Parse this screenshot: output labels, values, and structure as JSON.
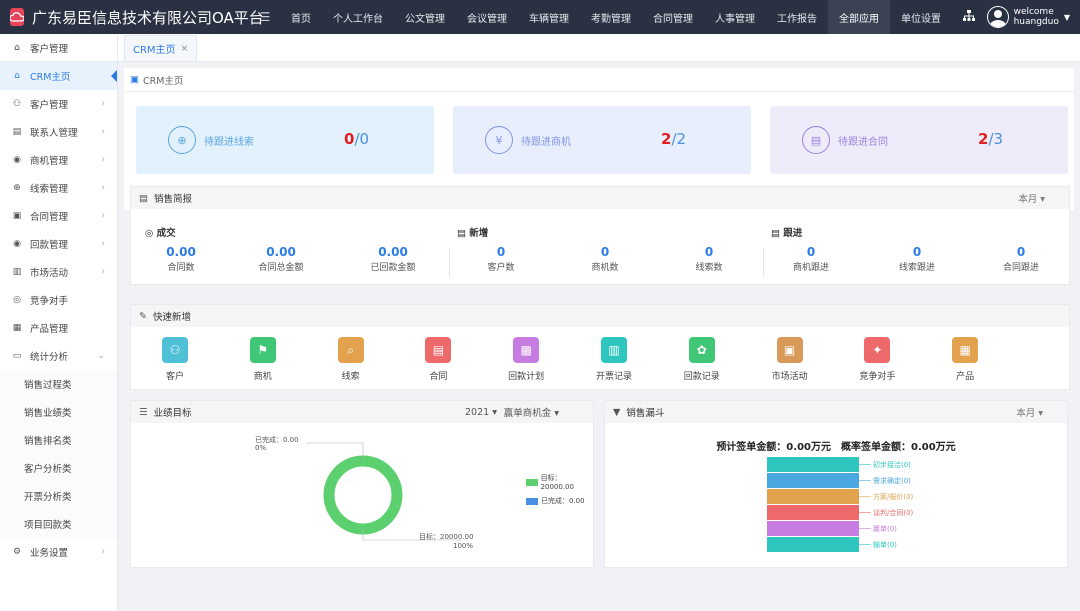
{
  "app": {
    "title": "广东易臣信息技术有限公司OA平台"
  },
  "nav": [
    "首页",
    "个人工作台",
    "公文管理",
    "会议管理",
    "车辆管理",
    "考勤管理",
    "合同管理",
    "人事管理",
    "工作报告",
    "全部应用",
    "单位设置"
  ],
  "user": {
    "line1": "welcome",
    "line2": "huangduo"
  },
  "sidebar": {
    "header": "客户管理",
    "items": [
      {
        "label": "CRM主页"
      },
      {
        "label": "客户管理"
      },
      {
        "label": "联系人管理"
      },
      {
        "label": "商机管理"
      },
      {
        "label": "线索管理"
      },
      {
        "label": "合同管理"
      },
      {
        "label": "回款管理"
      },
      {
        "label": "市场活动"
      },
      {
        "label": "竞争对手"
      },
      {
        "label": "产品管理"
      },
      {
        "label": "统计分析"
      }
    ],
    "subitems": [
      "销售过程类",
      "销售业绩类",
      "销售排名类",
      "客户分析类",
      "开票分析类",
      "项目回款类"
    ],
    "footer": "业务设置"
  },
  "tab": {
    "label": "CRM主页",
    "close": "×"
  },
  "breadcrumb": "CRM主页",
  "stats": [
    {
      "label": "待跟进线索",
      "done": "0",
      "total": "/0",
      "color": "#e3f1fc",
      "accent": "#5aa6e0"
    },
    {
      "label": "待跟进商机",
      "done": "2",
      "total": "/2",
      "color": "#e9eefc",
      "accent": "#7f95e6"
    },
    {
      "label": "待跟进合同",
      "done": "2",
      "total": "/3",
      "color": "#eeebfa",
      "accent": "#9a85de"
    }
  ],
  "briefing": {
    "title": "销售简报",
    "period": "本月",
    "groups": {
      "deal": "成交",
      "new": "新增",
      "follow": "跟进"
    },
    "metrics": [
      {
        "value": "0.00",
        "label": "合同数"
      },
      {
        "value": "0.00",
        "label": "合同总金额"
      },
      {
        "value": "0.00",
        "label": "已回款金额"
      },
      {
        "value": "0",
        "label": "客户数"
      },
      {
        "value": "0",
        "label": "商机数"
      },
      {
        "value": "0",
        "label": "线索数"
      },
      {
        "value": "0",
        "label": "商机跟进"
      },
      {
        "value": "0",
        "label": "线索跟进"
      },
      {
        "value": "0",
        "label": "合同跟进"
      }
    ]
  },
  "quick": {
    "title": "快速新增",
    "items": [
      {
        "label": "客户",
        "color": "#4fc1d6",
        "icon": "user-icon"
      },
      {
        "label": "商机",
        "color": "#3fc777",
        "icon": "opportunity-icon"
      },
      {
        "label": "线索",
        "color": "#e2a24e",
        "icon": "clue-icon"
      },
      {
        "label": "合同",
        "color": "#ee6a6a",
        "icon": "contract-icon"
      },
      {
        "label": "回款计划",
        "color": "#c67ce0",
        "icon": "plan-icon"
      },
      {
        "label": "开票记录",
        "color": "#2fc6c0",
        "icon": "invoice-icon"
      },
      {
        "label": "回款记录",
        "color": "#3fc777",
        "icon": "receipt-icon"
      },
      {
        "label": "市场活动",
        "color": "#d79a58",
        "icon": "activity-icon"
      },
      {
        "label": "竞争对手",
        "color": "#ee6a6a",
        "icon": "competitor-icon"
      },
      {
        "label": "产品",
        "color": "#e2a24e",
        "icon": "product-icon"
      }
    ]
  },
  "target": {
    "title": "业绩目标",
    "year": "2021",
    "metric": "赢单商机金",
    "chart_data": {
      "type": "pie",
      "labels": [
        "已完成",
        "目标"
      ],
      "values": [
        0.0,
        20000.0
      ],
      "percents": [
        "0%",
        "100%"
      ],
      "callouts": [
        "已完成：0.00",
        "目标：20000.00"
      ],
      "legend": [
        "目标：20000.00",
        "已完成：0.00"
      ],
      "colors": [
        "#4a90e2",
        "#5ccf6e"
      ]
    }
  },
  "funnel": {
    "title": "销售漏斗",
    "period": "本月",
    "summary": "预计签单金额：0.00万元　概率签单金额：0.00万元",
    "chart_data": {
      "type": "bar",
      "categories": [
        "初步接洽(0)",
        "需求确定(0)",
        "方案/报价(0)",
        "谈判/合同(0)",
        "赢单(0)",
        "输单(0)"
      ],
      "values": [
        0,
        0,
        0,
        0,
        0,
        0
      ],
      "colors": [
        "#2fc6c0",
        "#4aa8e0",
        "#e2a24e",
        "#ee6a6a",
        "#c67ce0",
        "#2fc6c0"
      ]
    }
  }
}
